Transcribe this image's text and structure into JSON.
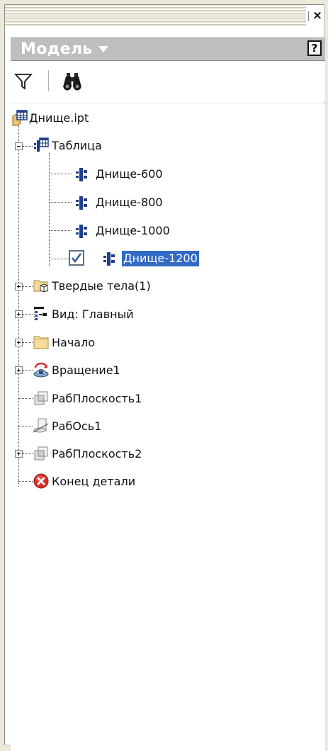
{
  "panel": {
    "title": "Модель",
    "help_label": "?",
    "close_label": "×"
  },
  "toolbar": {
    "filter_icon": "filter-icon",
    "find_icon": "binoculars-icon"
  },
  "tree": {
    "root": {
      "label": "Днище.ipt",
      "icon": "part-table-icon"
    },
    "table": {
      "label": "Таблица",
      "icon": "table-icon",
      "expanded": true
    },
    "members": [
      {
        "label": "Днище-600",
        "icon": "member-icon"
      },
      {
        "label": "Днище-800",
        "icon": "member-icon"
      },
      {
        "label": "Днище-1000",
        "icon": "member-icon"
      },
      {
        "label": "Днище-1200",
        "icon": "member-icon",
        "active": true,
        "selected": true
      }
    ],
    "items": [
      {
        "label": "Твердые тела(1)",
        "icon": "solid-bodies-icon",
        "expandable": true
      },
      {
        "label": "Вид: Главный",
        "icon": "view-rep-icon",
        "expandable": true
      },
      {
        "label": "Начало",
        "icon": "folder-icon",
        "expandable": true
      },
      {
        "label": "Вращение1",
        "icon": "revolve-icon",
        "expandable": true
      },
      {
        "label": "РабПлоскость1",
        "icon": "workplane-icon",
        "expandable": false
      },
      {
        "label": "РабОсь1",
        "icon": "workaxis-icon",
        "expandable": false
      },
      {
        "label": "РабПлоскость2",
        "icon": "workplane-icon",
        "expandable": true
      },
      {
        "label": "Конец детали",
        "icon": "end-of-part-icon",
        "expandable": false
      }
    ]
  },
  "colors": {
    "selection": "#316ac5",
    "title_bar": "#bebebe",
    "end_of_part": "#d9302c"
  }
}
